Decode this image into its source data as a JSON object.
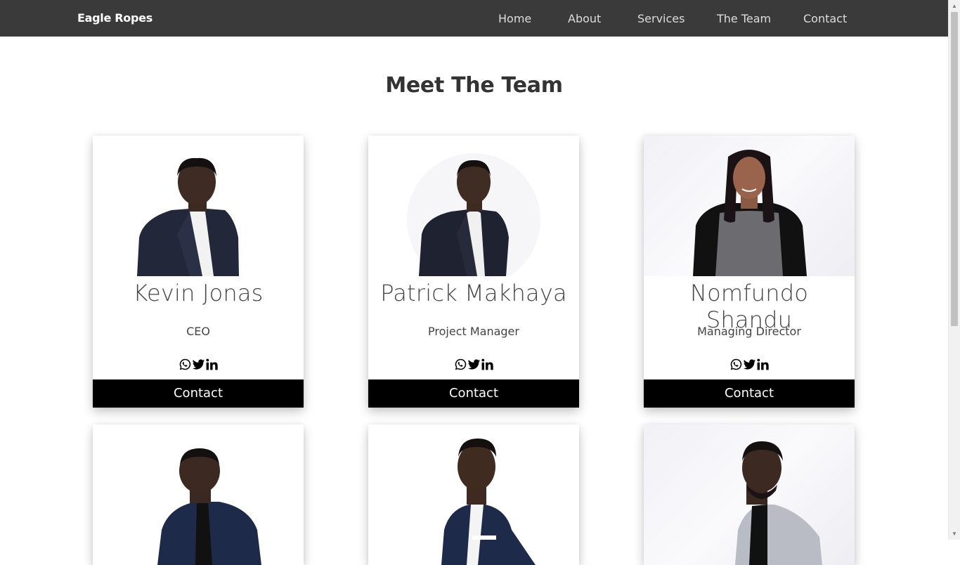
{
  "navbar": {
    "brand": "Eagle Ropes",
    "links": [
      "Home",
      "About",
      "Services",
      "The Team",
      "Contact"
    ]
  },
  "section": {
    "title": "Meet The Team"
  },
  "team": [
    {
      "name": "Kevin Jonas",
      "role": "CEO",
      "contact_label": "Contact",
      "photo_icon": "portrait-man-dark-suit"
    },
    {
      "name": "Patrick Makhaya",
      "role": "Project Manager",
      "contact_label": "Contact",
      "photo_icon": "portrait-man-dark-suit"
    },
    {
      "name": "Nomfundo Shandu",
      "role": "Managing Director",
      "contact_label": "Contact",
      "photo_icon": "portrait-woman-grey-dress"
    },
    {
      "photo_icon": "portrait-man-navy-blazer"
    },
    {
      "photo_icon": "portrait-man-navy-blazer"
    },
    {
      "photo_icon": "portrait-man-grey-blazer"
    }
  ],
  "social_icons": [
    "whatsapp-icon",
    "twitter-icon",
    "linkedin-icon"
  ],
  "colors": {
    "navbar": "#3a3a3a",
    "contact_button": "#000000",
    "nav_text": "#dddddd"
  }
}
